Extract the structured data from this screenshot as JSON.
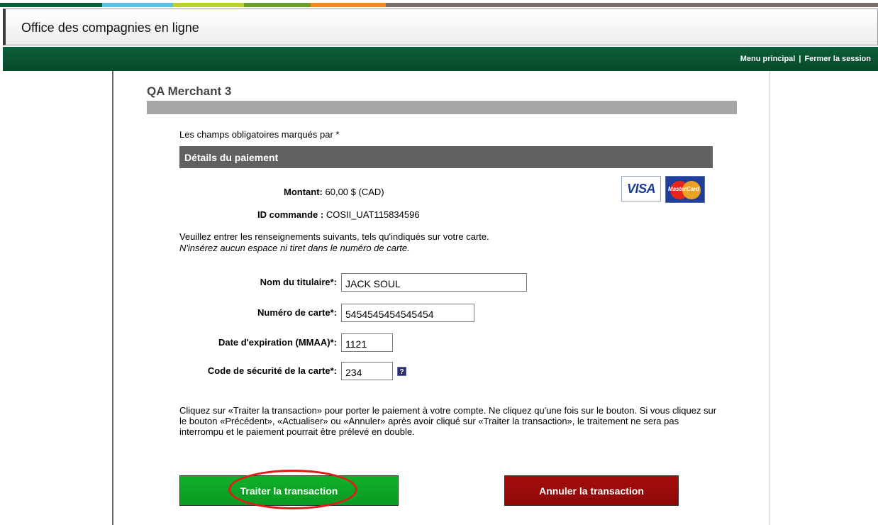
{
  "header": {
    "app_title": "Office des compagnies en ligne",
    "strip_colors": [
      "#0c5f3a",
      "#5bc0de",
      "#bcd230",
      "#6a9e2a",
      "#f08a1e",
      "#7a6f6a"
    ]
  },
  "nav": {
    "main_menu": "Menu principal",
    "separator": "|",
    "logout": "Fermer la session"
  },
  "merchant": {
    "name": "QA Merchant 3"
  },
  "form": {
    "required_note": "Les champs obligatoires marqués par *",
    "section_title": "Détails du paiement",
    "amount_label": "Montant:",
    "amount_value": "60,00 $ (CAD)",
    "order_label": "ID commande :",
    "order_value": "COSII_UAT115834596",
    "instructions_line1": "Veuillez entrer les renseignements suivants, tels qu'indiqués sur votre carte.",
    "instructions_line2": "N'insérez aucun espace ni tiret dans le numéro de carte.",
    "cards": {
      "visa": "VISA",
      "mastercard": "MasterCard"
    },
    "fields": {
      "cardholder": {
        "label": "Nom du titulaire*:",
        "value": "JACK SOUL"
      },
      "card_number": {
        "label": "Numéro de carte*:",
        "value": "5454545454545454"
      },
      "expiry": {
        "label": "Date d'expiration (MMAA)*:",
        "value": "1121"
      },
      "cvv": {
        "label": "Code de sécurité de la carte*:",
        "value": "234",
        "help": "?"
      }
    },
    "notice": "Cliquez sur «Traiter la transaction» pour porter le paiement à votre compte. Ne cliquez qu'une fois sur le bouton. Si vous cliquez sur le bouton «Précédent», «Actualiser» ou «Annuler» après avoir cliqué sur «Traiter la transaction», le traitement ne sera pas interrompu et le paiement pourrait être prélevé en double."
  },
  "buttons": {
    "submit": "Traiter la transaction",
    "cancel": "Annuler la transaction"
  },
  "colors": {
    "nav_green": "#0c5f3a",
    "submit_green": "#0fb02a",
    "cancel_red": "#a50d0d",
    "highlight_red": "#e01b1b"
  }
}
